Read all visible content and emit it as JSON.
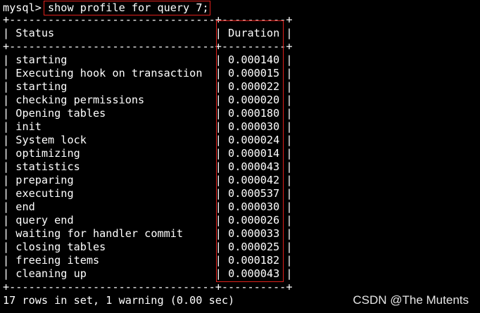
{
  "terminal": {
    "prompt": "mysql> ",
    "command": "show profile for query 7;",
    "border_lines": {
      "top": "+--------------------------------+----------+",
      "mid": "+--------------------------------+----------+",
      "bottom": "+--------------------------------+----------+"
    },
    "header": {
      "status": "Status",
      "duration": "Duration"
    },
    "rows": [
      {
        "status": "starting",
        "duration": "0.000140"
      },
      {
        "status": "Executing hook on transaction",
        "duration": "0.000015"
      },
      {
        "status": "starting",
        "duration": "0.000022"
      },
      {
        "status": "checking permissions",
        "duration": "0.000020"
      },
      {
        "status": "Opening tables",
        "duration": "0.000180"
      },
      {
        "status": "init",
        "duration": "0.000030"
      },
      {
        "status": "System lock",
        "duration": "0.000024"
      },
      {
        "status": "optimizing",
        "duration": "0.000014"
      },
      {
        "status": "statistics",
        "duration": "0.000043"
      },
      {
        "status": "preparing",
        "duration": "0.000042"
      },
      {
        "status": "executing",
        "duration": "0.000537"
      },
      {
        "status": "end",
        "duration": "0.000030"
      },
      {
        "status": "query end",
        "duration": "0.000026"
      },
      {
        "status": "waiting for handler commit",
        "duration": "0.000033"
      },
      {
        "status": "closing tables",
        "duration": "0.000025"
      },
      {
        "status": "freeing items",
        "duration": "0.000182"
      },
      {
        "status": "cleaning up",
        "duration": "0.000043"
      }
    ],
    "footer": "17 rows in set, 1 warning (0.00 sec)"
  },
  "watermark": "CSDN @The Mutents",
  "colors": {
    "background": "#000000",
    "text": "#ffffff",
    "highlight_border": "#e0201b"
  }
}
